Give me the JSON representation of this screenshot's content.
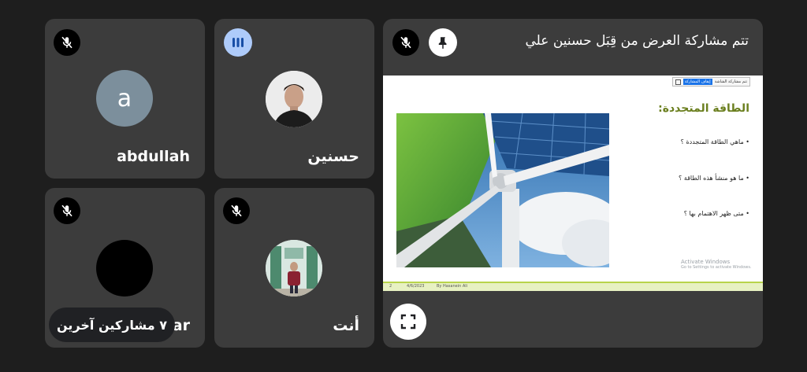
{
  "presenter": {
    "banner": "تتم مشاركة العرض من قِبَل حسنين علي",
    "pin_icon": "pin-icon",
    "mic_icon": "mic-off-icon",
    "fullscreen_icon": "fullscreen-icon"
  },
  "slide": {
    "title": "الطاقة المتجددة:",
    "bullets": [
      "ماهي الطاقة المتجددة ؟",
      "ما هو منشأ هذه الطاقة ؟",
      "متى ظهر الاهتمام بها ؟"
    ],
    "watermark_title": "Activate Windows",
    "watermark_sub": "Go to Settings to activate Windows.",
    "footer_page": "2",
    "footer_date": "4/6/2023",
    "footer_author": "By Hasanein Ali",
    "toolbar_button": "إيقاف المشاركة",
    "toolbar_text": "تتم مشاركة الشاشة"
  },
  "participants": [
    {
      "name": "abdullah",
      "initial": "a",
      "avatar_color": "#7c8f9c",
      "muted": true
    },
    {
      "name": "حسنين",
      "muted": false,
      "speaking": true
    },
    {
      "name": "ar",
      "muted": true
    },
    {
      "name": "أنت",
      "muted": true
    }
  ],
  "others_pill": "٧ مشاركين آخرين",
  "colors": {
    "background": "#1e1e1e",
    "tile": "#3c3c3c",
    "speaking": "#aecbfa",
    "accent": "#1a73e8",
    "slide_title": "#6b7f1f"
  }
}
